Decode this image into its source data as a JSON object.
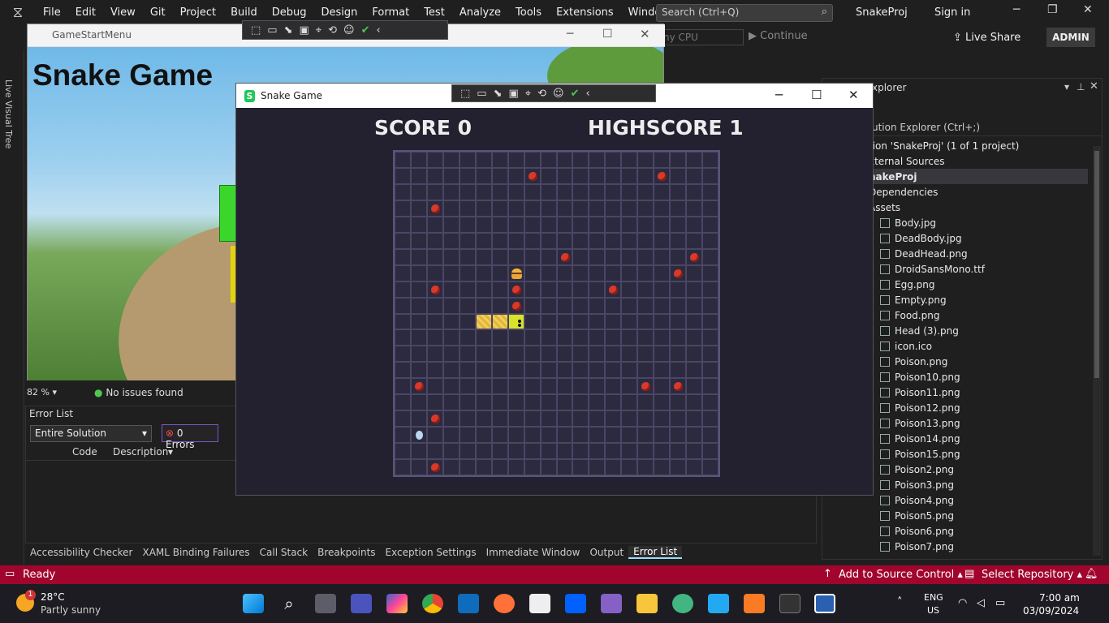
{
  "menubar": {
    "items": [
      "File",
      "Edit",
      "View",
      "Git",
      "Project",
      "Build",
      "Debug",
      "Design",
      "Format",
      "Test",
      "Analyze",
      "Tools",
      "Extensions",
      "Window",
      "Help"
    ],
    "search_placeholder": "Search (Ctrl+Q)",
    "project": "SnakeProj",
    "signin": "Sign in"
  },
  "toolbar": {
    "cpu": "ny CPU",
    "continue": "Continue",
    "liveshare": "Live Share",
    "user": "ADMIN"
  },
  "side": {
    "live_visual_tree": "Live Visual Tree"
  },
  "gamestart": {
    "window_title": "GameStartMenu",
    "heading": "Snake Game"
  },
  "designer_status": {
    "zoom": "82 %",
    "issues": "No issues found"
  },
  "errorlist": {
    "title": "Error List",
    "scope": "Entire Solution",
    "errors": "0 Errors",
    "col_code": "Code",
    "col_desc": "Description"
  },
  "bottom_tabs": [
    "Accessibility Checker",
    "XAML Binding Failures",
    "Call Stack",
    "Breakpoints",
    "Exception Settings",
    "Immediate Window",
    "Output",
    "Error List"
  ],
  "solution": {
    "title": "xplorer",
    "search": "ution Explorer (Ctrl+;)",
    "rows": [
      "tion 'SnakeProj' (1 of 1 project)",
      "xternal Sources",
      "nakeProj",
      "Dependencies",
      "Assets",
      "Body.jpg",
      "DeadBody.jpg",
      "DeadHead.png",
      "DroidSansMono.ttf",
      "Egg.png",
      "Empty.png",
      "Food.png",
      "Head (3).png",
      "icon.ico",
      "Poison.png",
      "Poison10.png",
      "Poison11.png",
      "Poison12.png",
      "Poison13.png",
      "Poison14.png",
      "Poison15.png",
      "Poison2.png",
      "Poison3.png",
      "Poison4.png",
      "Poison5.png",
      "Poison6.png",
      "Poison7.png"
    ]
  },
  "statusbar": {
    "ready": "Ready",
    "source": "Add to Source Control",
    "repo": "Select Repository"
  },
  "taskbar": {
    "temp": "28°C",
    "weather": "Partly sunny",
    "badge": "1",
    "lang1": "ENG",
    "lang2": "US",
    "time": "7:00 am",
    "date": "03/09/2024"
  },
  "game": {
    "window_title": "Snake Game",
    "score": "SCORE 0",
    "highscore": "HIGHSCORE 1",
    "grid_size": 20,
    "poison": [
      [
        8,
        1
      ],
      [
        16,
        1
      ],
      [
        2,
        3
      ],
      [
        10,
        6
      ],
      [
        18,
        6
      ],
      [
        17,
        7
      ],
      [
        2,
        8
      ],
      [
        7,
        8
      ],
      [
        13,
        8
      ],
      [
        7,
        9
      ],
      [
        1,
        14
      ],
      [
        15,
        14
      ],
      [
        17,
        14
      ],
      [
        2,
        16
      ],
      [
        2,
        19
      ]
    ],
    "food": [
      [
        7,
        7
      ]
    ],
    "body": [
      [
        5,
        10
      ],
      [
        6,
        10
      ]
    ],
    "head": [
      [
        7,
        10
      ]
    ],
    "egg": [
      [
        1,
        17
      ]
    ]
  }
}
